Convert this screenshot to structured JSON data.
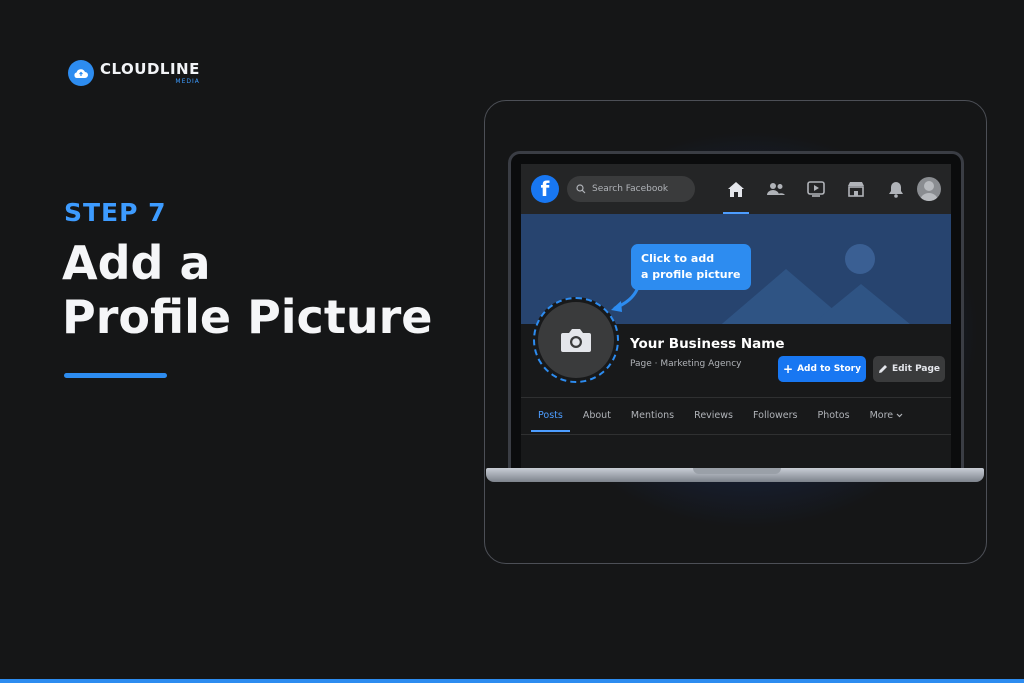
{
  "brand": {
    "name": "CLOUDLINE",
    "sub": "MEDIA",
    "accent": "#2d8cf0"
  },
  "hero": {
    "step": "STEP 7",
    "title_line1": "Add a",
    "title_line2": "Profile Picture"
  },
  "facebook": {
    "logo_letter": "f",
    "search_placeholder": "Search Facebook",
    "nav_icons": [
      "home-icon",
      "friends-icon",
      "video-icon",
      "marketplace-icon",
      "bell-icon"
    ],
    "tooltip_line1": "Click to add",
    "tooltip_line2": "a profile picture",
    "page_name": "Your Business Name",
    "page_subtitle": "Page · Marketing Agency",
    "add_story_label": "Add to Story",
    "edit_page_label": "Edit Page",
    "tabs": [
      "Posts",
      "About",
      "Mentions",
      "Reviews",
      "Followers",
      "Photos",
      "More"
    ],
    "active_tab": "Posts",
    "colors": {
      "fb_blue": "#1877f2",
      "cover": "#27446f",
      "surface": "#242526"
    }
  }
}
